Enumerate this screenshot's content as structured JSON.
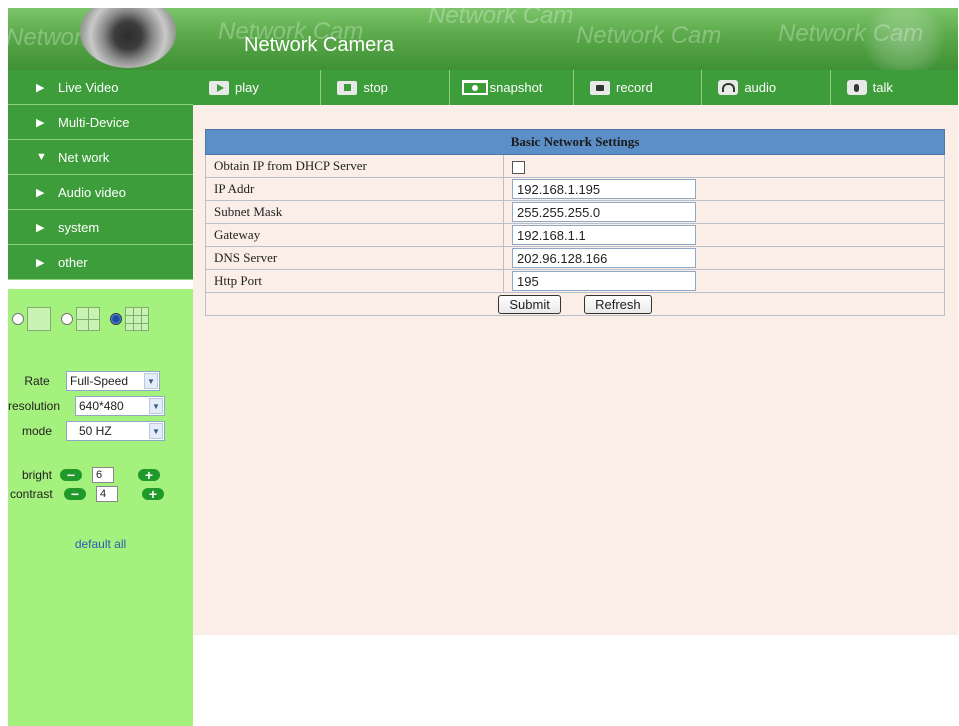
{
  "header": {
    "title": "Network Camera",
    "watermarks": [
      "Network Cam",
      "Network Cam",
      "Network Cam",
      "Network Cam",
      "Network Cam"
    ]
  },
  "sidebar": {
    "items": [
      {
        "label": "Live Video",
        "arrow": "▶"
      },
      {
        "label": "Multi-Device",
        "arrow": "▶"
      },
      {
        "label": "Net work",
        "arrow": "▼"
      },
      {
        "label": "Audio video",
        "arrow": "▶"
      },
      {
        "label": "system",
        "arrow": "▶"
      },
      {
        "label": "other",
        "arrow": "▶"
      }
    ],
    "layout_selected": "4-split",
    "controls": {
      "rate_label": "Rate",
      "rate_value": "Full-Speed",
      "resolution_label": "resolution",
      "resolution_value": "640*480",
      "mode_label": "mode",
      "mode_value": "50 HZ",
      "bright_label": "bright",
      "bright_value": "6",
      "contrast_label": "contrast",
      "contrast_value": "4",
      "minus": "−",
      "plus": "+",
      "default_all": "default all"
    }
  },
  "toolbar": {
    "play": "play",
    "stop": "stop",
    "snapshot": "snapshot",
    "record": "record",
    "audio": "audio",
    "talk": "talk"
  },
  "settings": {
    "title": "Basic Network Settings",
    "rows": [
      {
        "label": "Obtain IP from DHCP Server",
        "type": "checkbox",
        "checked": false
      },
      {
        "label": "IP Addr",
        "type": "text",
        "value": "192.168.1.195"
      },
      {
        "label": "Subnet Mask",
        "type": "text",
        "value": "255.255.255.0"
      },
      {
        "label": "Gateway",
        "type": "text",
        "value": "192.168.1.1"
      },
      {
        "label": "DNS Server",
        "type": "text",
        "value": "202.96.128.166"
      },
      {
        "label": "Http Port",
        "type": "text",
        "value": "195"
      }
    ],
    "submit": "Submit",
    "refresh": "Refresh"
  },
  "colors": {
    "nav_green": "#3d9d3a",
    "sidebar_light_green": "#a5f17e",
    "content_bg": "#faeee6",
    "table_header": "#5c8fc8",
    "link_blue": "#2a5fae"
  }
}
